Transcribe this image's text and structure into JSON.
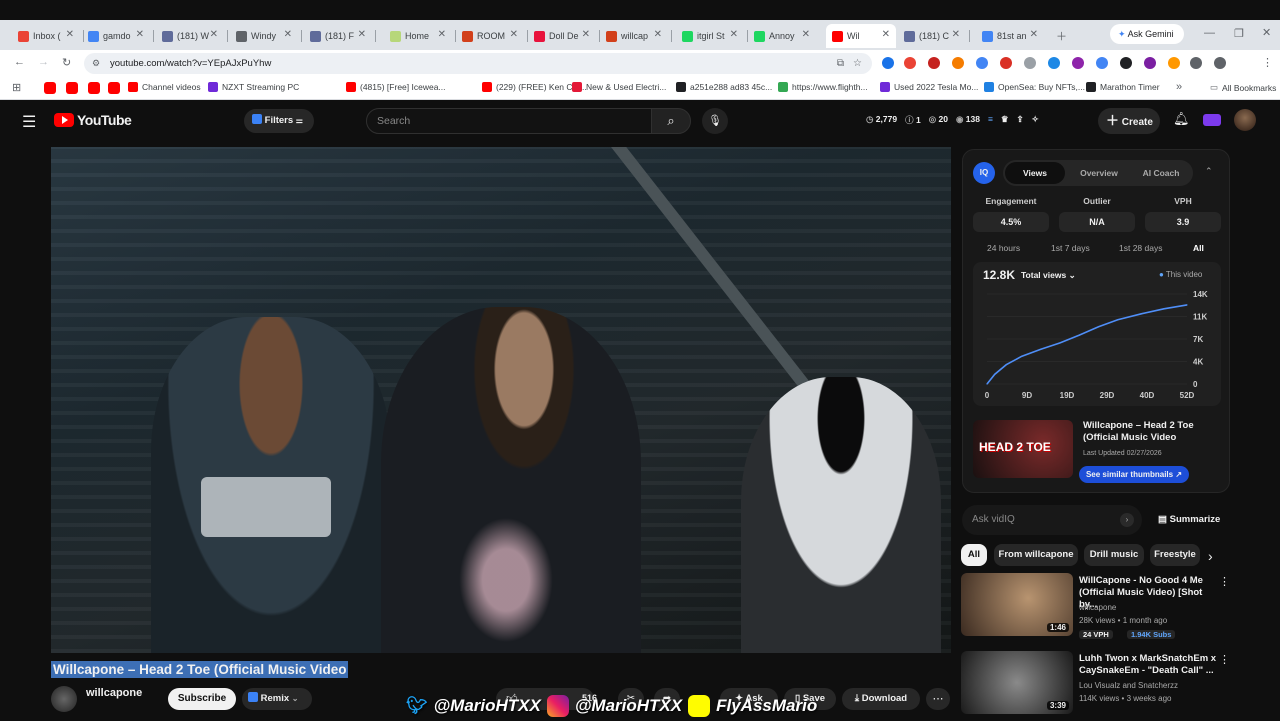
{
  "browser": {
    "tabs": [
      {
        "label": "Inbox (",
        "color": "#ea4335"
      },
      {
        "label": "gamdo",
        "color": "#4285f4"
      },
      {
        "label": "(181) W",
        "color": "#5f6b9a"
      },
      {
        "label": "Windy",
        "color": "#5f6368"
      },
      {
        "label": "(181) F",
        "color": "#5f6b9a"
      },
      {
        "label": "Home",
        "color": "#b7d77a"
      },
      {
        "label": "ROOM",
        "color": "#d2401b"
      },
      {
        "label": "Doll De",
        "color": "#e8133c"
      },
      {
        "label": "willcap",
        "color": "#d2401b"
      },
      {
        "label": "itgirl St",
        "color": "#1ed760"
      },
      {
        "label": "Annoy",
        "color": "#1ed760"
      },
      {
        "label": "Wil",
        "color": "#ff0000"
      },
      {
        "label": "(181) C",
        "color": "#5f6b9a"
      },
      {
        "label": "81st an",
        "color": "#4285f4"
      }
    ],
    "ask_gemini": "Ask Gemini",
    "url": "youtube.com/watch?v=YEpAJxPuYhw",
    "bookmarks": [
      {
        "label": "Channel videos",
        "color": "#ff0000"
      },
      {
        "label": "NZXT Streaming PC",
        "color": "#6f2ad8"
      },
      {
        "label": "(4815) [Free] Icewea...",
        "color": "#ff0000"
      },
      {
        "label": "(229) (FREE) Ken Car...",
        "color": "#ff0000"
      },
      {
        "label": "New & Used Electri...",
        "color": "#e31937"
      },
      {
        "label": "a251e288 ad83 45c...",
        "color": "#202124"
      },
      {
        "label": "https://www.flighth...",
        "color": "#34a853"
      },
      {
        "label": "Used 2022 Tesla Mo...",
        "color": "#6f2ad8"
      },
      {
        "label": "OpenSea: Buy NFTs,...",
        "color": "#2081e2"
      },
      {
        "label": "Marathon Timer",
        "color": "#202124"
      }
    ],
    "all_bookmarks": "All Bookmarks"
  },
  "youtube": {
    "logo": "YouTube",
    "filters": "Filters",
    "search_placeholder": "Search",
    "stats": {
      "a": "2,779",
      "b": "1",
      "c": "20",
      "d": "138"
    },
    "create": "Create",
    "video_title": "Willcapone – Head 2 Toe (Official Music Video",
    "channel": "willcapone",
    "subscribe": "Subscribe",
    "remix": "Remix",
    "likes": "516",
    "ask": "Ask",
    "save": "Save",
    "download": "Download"
  },
  "vidiq": {
    "tabs": [
      "Views",
      "Overview",
      "AI Coach"
    ],
    "metrics": [
      {
        "label": "Engagement",
        "value": "4.5%"
      },
      {
        "label": "Outlier",
        "value": "N/A"
      },
      {
        "label": "VPH",
        "value": "3.9"
      }
    ],
    "ranges": [
      "24 hours",
      "1st 7 days",
      "1st 28 days",
      "All"
    ],
    "total": "12.8K",
    "total_label": "Total views",
    "legend": "This video",
    "thumb_title": "Willcapone – Head 2 Toe (Official Music Video",
    "last_updated": "Last Updated 02/27/2026",
    "similar": "See similar thumbnails ↗",
    "ask_placeholder": "Ask vidIQ",
    "summarize": "Summarize",
    "thumb_text": "HEAD 2 TOE"
  },
  "chart_data": {
    "type": "line",
    "x_ticks": [
      "0",
      "9D",
      "19D",
      "29D",
      "40D",
      "52D"
    ],
    "y_ticks": [
      "14K",
      "11K",
      "7K",
      "4K",
      "0"
    ],
    "series": [
      {
        "name": "This video",
        "x": [
          0,
          2,
          5,
          9,
          14,
          19,
          24,
          29,
          34,
          40,
          46,
          52
        ],
        "y": [
          0,
          1500,
          3000,
          4300,
          5400,
          6400,
          7600,
          8900,
          10000,
          10900,
          11700,
          12300
        ]
      }
    ],
    "xlim": [
      0,
      52
    ],
    "ylim": [
      0,
      14000
    ],
    "grid": true
  },
  "filter_chips": [
    "All",
    "From willcapone",
    "Drill music",
    "Freestyle"
  ],
  "recommendations": [
    {
      "title": "WillCapone - No Good 4 Me (Official Music Video) [Shot by...",
      "channel": "willcapone",
      "meta": "28K views • 1 month ago",
      "duration": "1:46",
      "badges": [
        "24 VPH",
        "1.94K Subs"
      ]
    },
    {
      "title": "Luhh Twon x MarkSnatchEm x CaySnakeEm - \"Death Call\" ...",
      "channel": "Lou Visualz and Snatcherzz",
      "meta": "114K views • 3 weeks ago",
      "duration": "3:39",
      "badges": []
    }
  ],
  "watermark": {
    "twitter": "@MarioHTXX",
    "instagram": "@MarioHTXX",
    "snapchat": "FlyAssMario"
  }
}
